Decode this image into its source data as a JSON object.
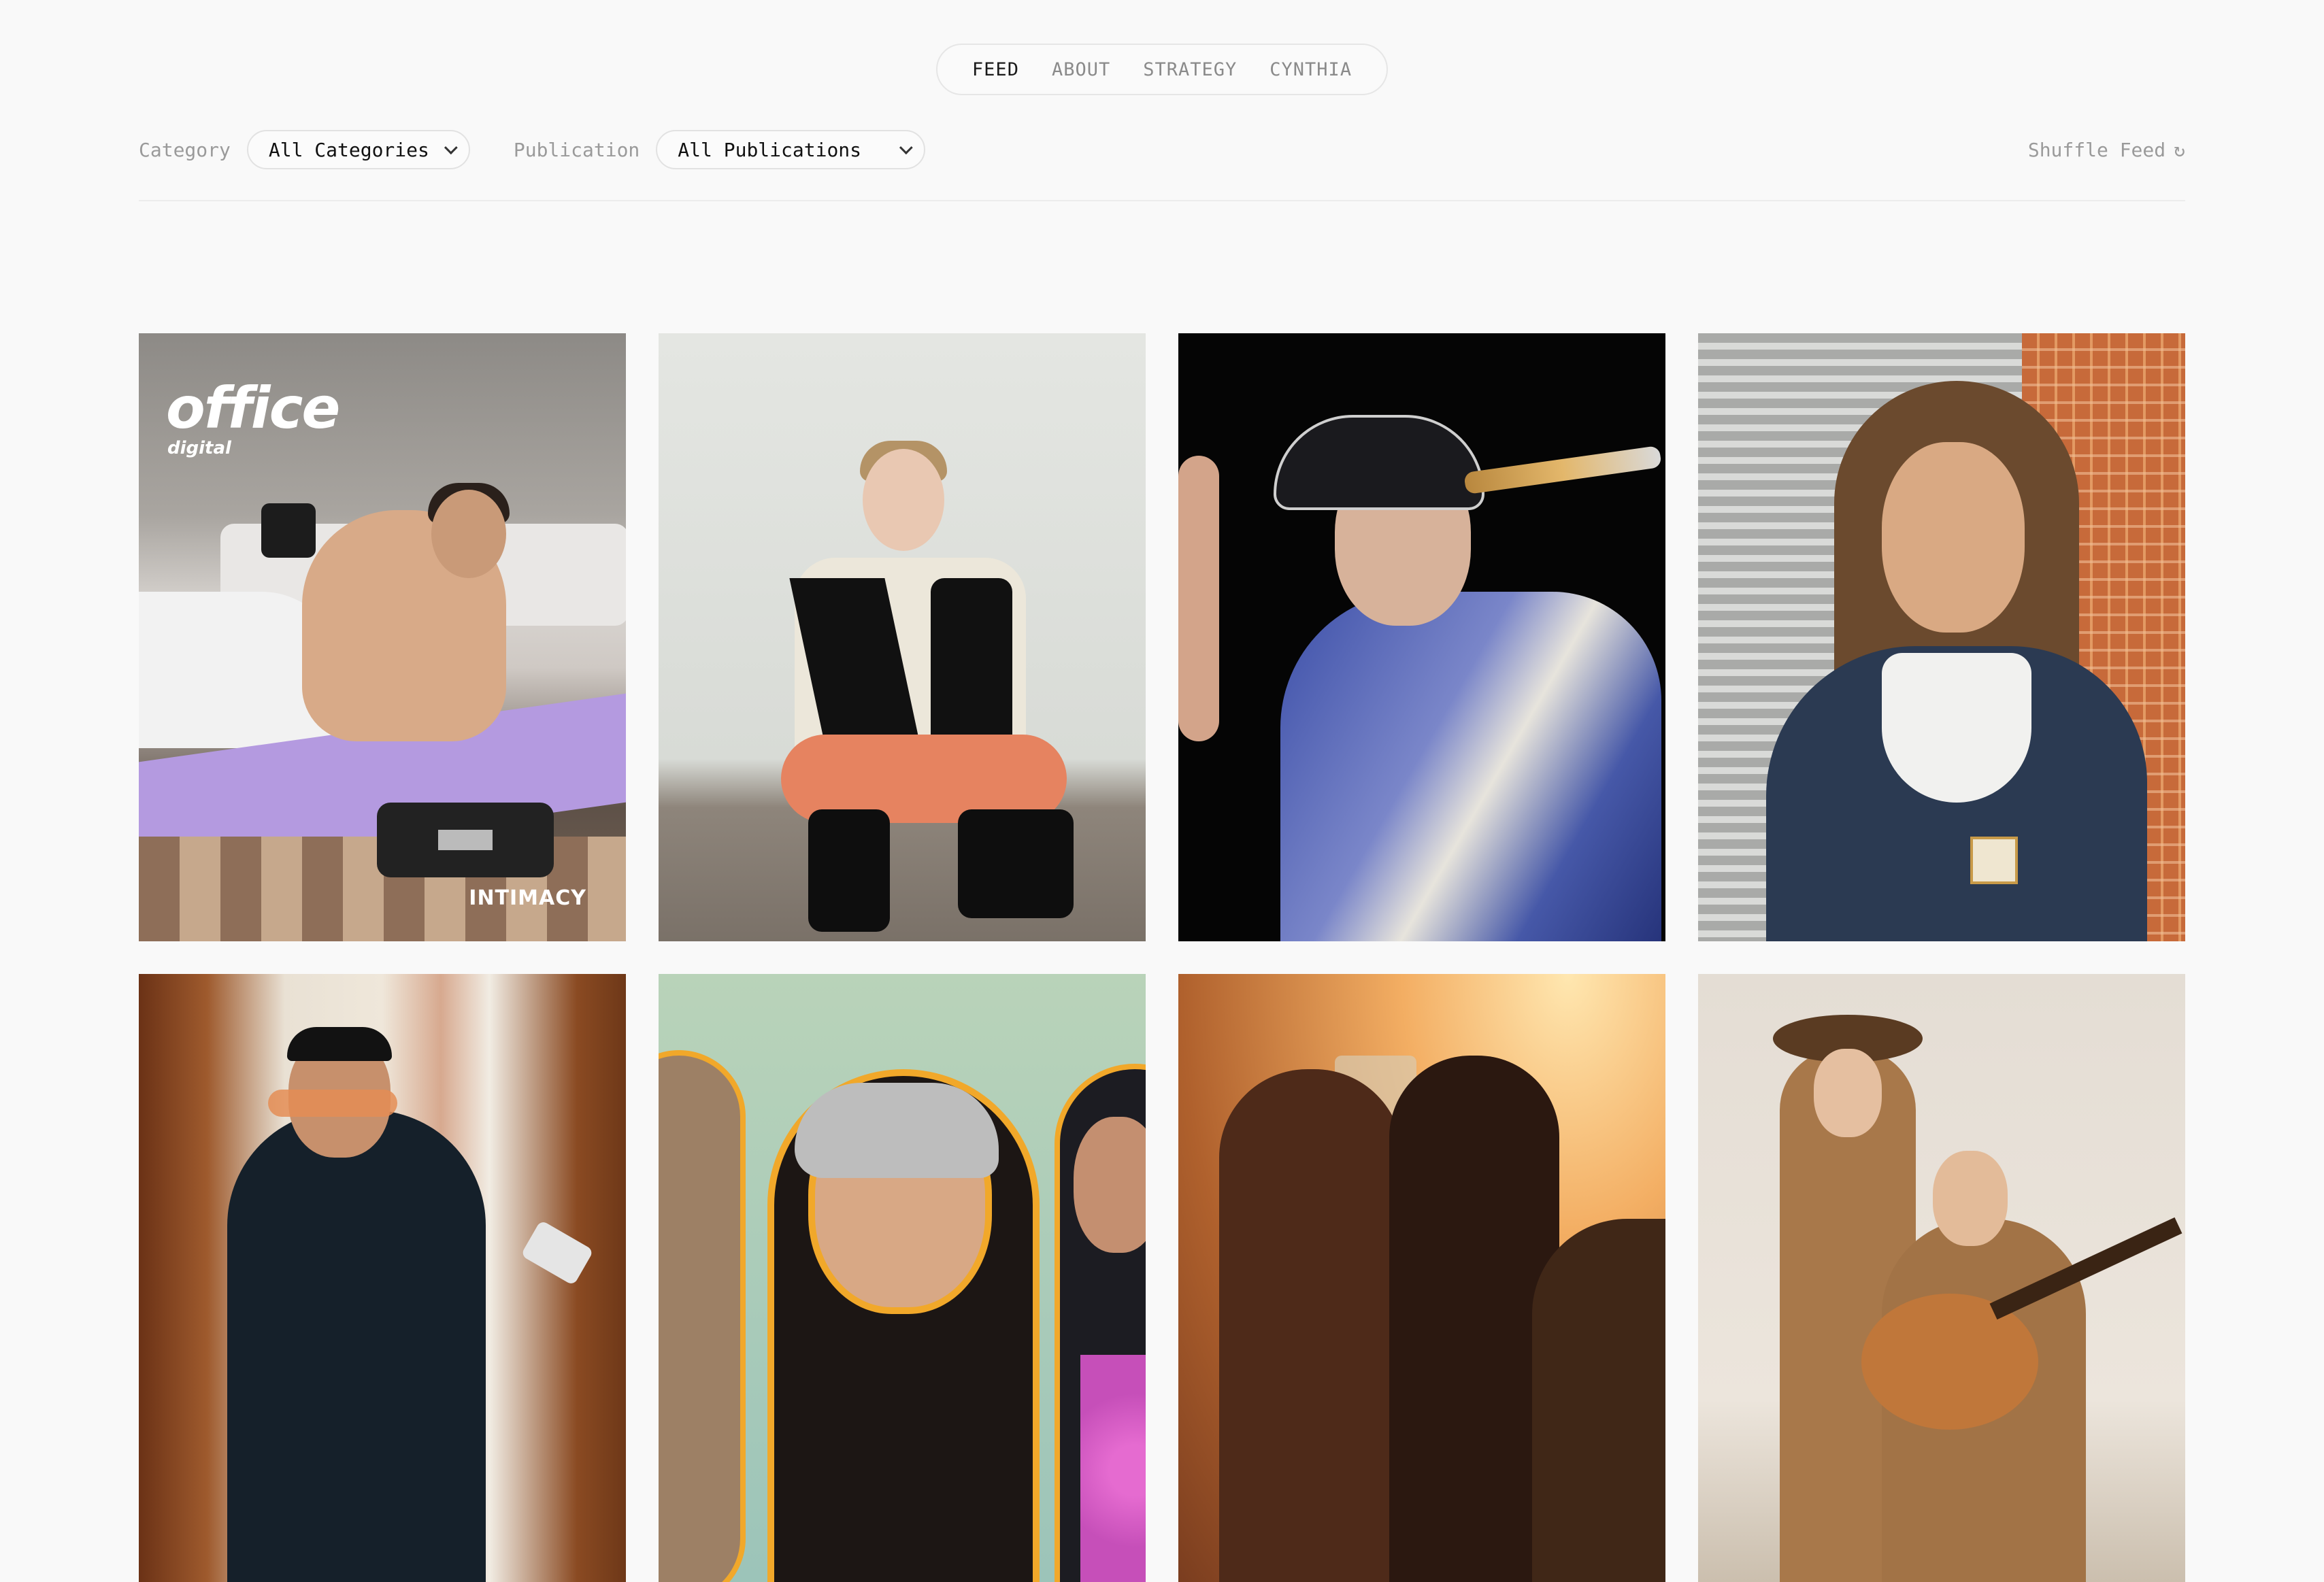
{
  "nav": {
    "items": [
      {
        "label": "FEED",
        "active": true
      },
      {
        "label": "ABOUT",
        "active": false
      },
      {
        "label": "STRATEGY",
        "active": false
      },
      {
        "label": "CYNTHIA",
        "active": false
      }
    ]
  },
  "filters": {
    "category_label": "Category",
    "category_value": "All Categories",
    "publication_label": "Publication",
    "publication_value": "All Publications",
    "shuffle_label": "Shuffle Feed",
    "shuffle_icon": "refresh-icon",
    "shuffle_glyph": "↻"
  },
  "feed": {
    "cards": [
      {
        "logo": "office",
        "logo_sub": "digital",
        "tag": "INTIMACY"
      },
      {},
      {},
      {},
      {},
      {},
      {},
      {}
    ]
  },
  "colors": {
    "background": "#f9f9f9",
    "nav_active": "#1a1a1a",
    "nav_inactive": "#8a8a8a",
    "label_gray": "#9a9a9a"
  }
}
